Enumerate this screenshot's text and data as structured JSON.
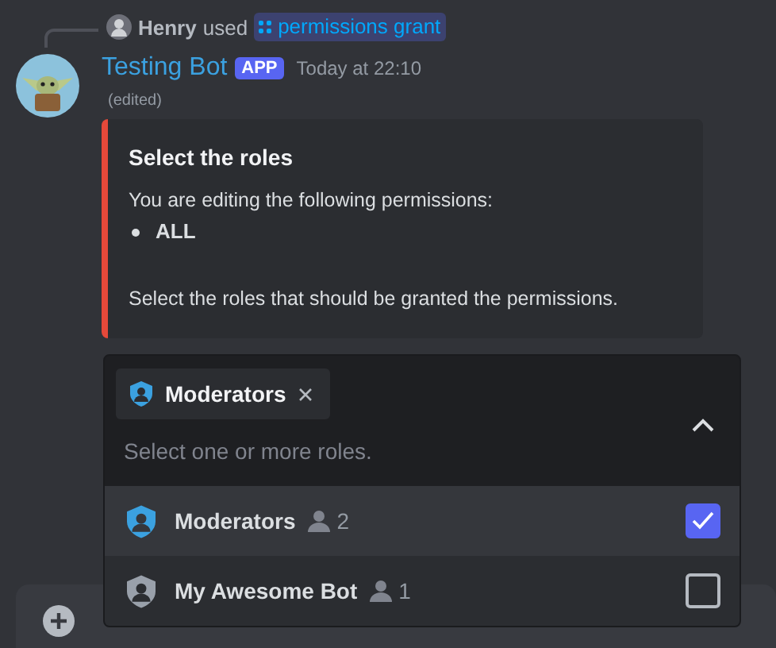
{
  "reply": {
    "user": "Henry",
    "action": "used",
    "command": "permissions grant"
  },
  "message": {
    "author": "Testing Bot",
    "badge": "APP",
    "timestamp": "Today at 22:10",
    "edited": "(edited)"
  },
  "embed": {
    "title": "Select the roles",
    "description": "You are editing the following permissions:",
    "bullets": [
      "ALL"
    ],
    "footer": "Select the roles that should be granted the permissions."
  },
  "select": {
    "expanded": true,
    "chips": [
      {
        "label": "Moderators",
        "color": "#3ba1e0"
      }
    ],
    "placeholder": "Select one or more roles.",
    "options": [
      {
        "label": "Moderators",
        "count": "2",
        "color": "#3ba1e0",
        "checked": true,
        "highlighted": true
      },
      {
        "label": "My Awesome Bot",
        "count": "1",
        "color": "#99a0aa",
        "checked": false,
        "highlighted": false
      }
    ]
  }
}
